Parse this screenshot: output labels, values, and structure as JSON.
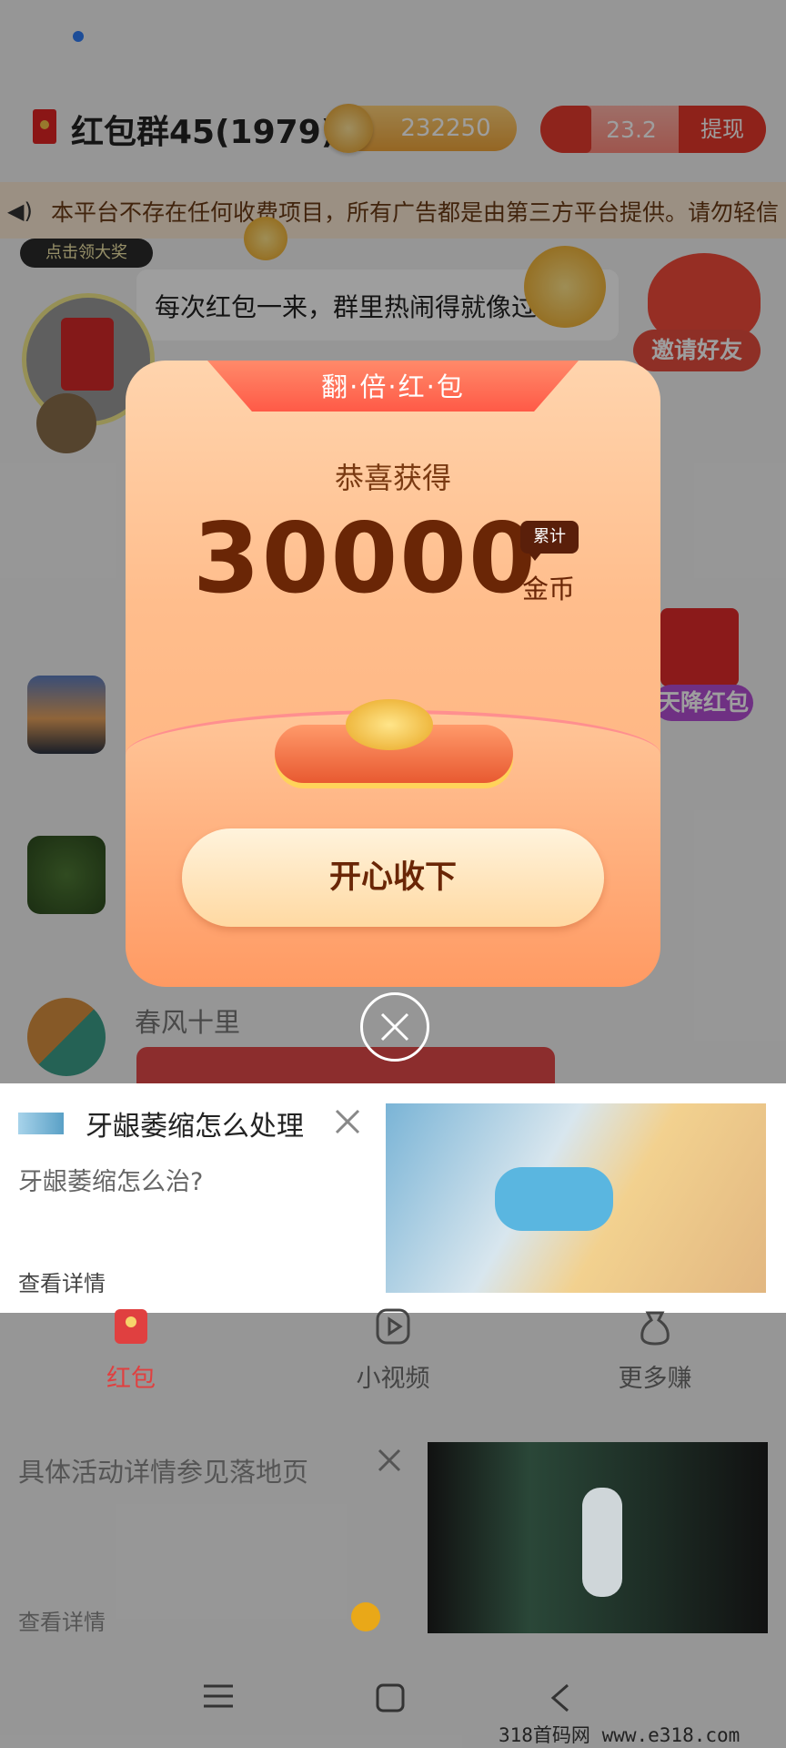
{
  "header": {
    "group_title": "红包群45(1979)",
    "coin_balance": "232250",
    "cash_balance": "23.2",
    "withdraw_label": "提现"
  },
  "notice": {
    "text": "本平台不存在任何收费项目，所有广告都是由第三方平台提供。请勿轻信"
  },
  "chat": {
    "award_tag": "点击领大奖",
    "message": "每次红包一来，群里热闹得就像过年！",
    "invite_label": "邀请好友",
    "drop_label": "天降红包",
    "sender_name": "春风十里"
  },
  "modal": {
    "banner": "翻·倍·红·包",
    "congrats": "恭喜获得",
    "amount": "30000",
    "badge": "累计",
    "unit": "金币",
    "collect_label": "开心收下"
  },
  "ad1": {
    "title": "牙龈萎缩怎么处理",
    "subtitle": "牙龈萎缩怎么治?",
    "detail_label": "查看详情"
  },
  "bottom_nav": [
    {
      "label": "红包",
      "active": true
    },
    {
      "label": "小视频",
      "active": false
    },
    {
      "label": "更多赚",
      "active": false
    }
  ],
  "ad2": {
    "text": "具体活动详情参见落地页",
    "detail_label": "查看详情"
  },
  "watermark": "318首码网  www.e318.com",
  "colors": {
    "accent_red": "#e5372b",
    "modal_brown": "#6a2606",
    "nav_active": "#e04040"
  }
}
